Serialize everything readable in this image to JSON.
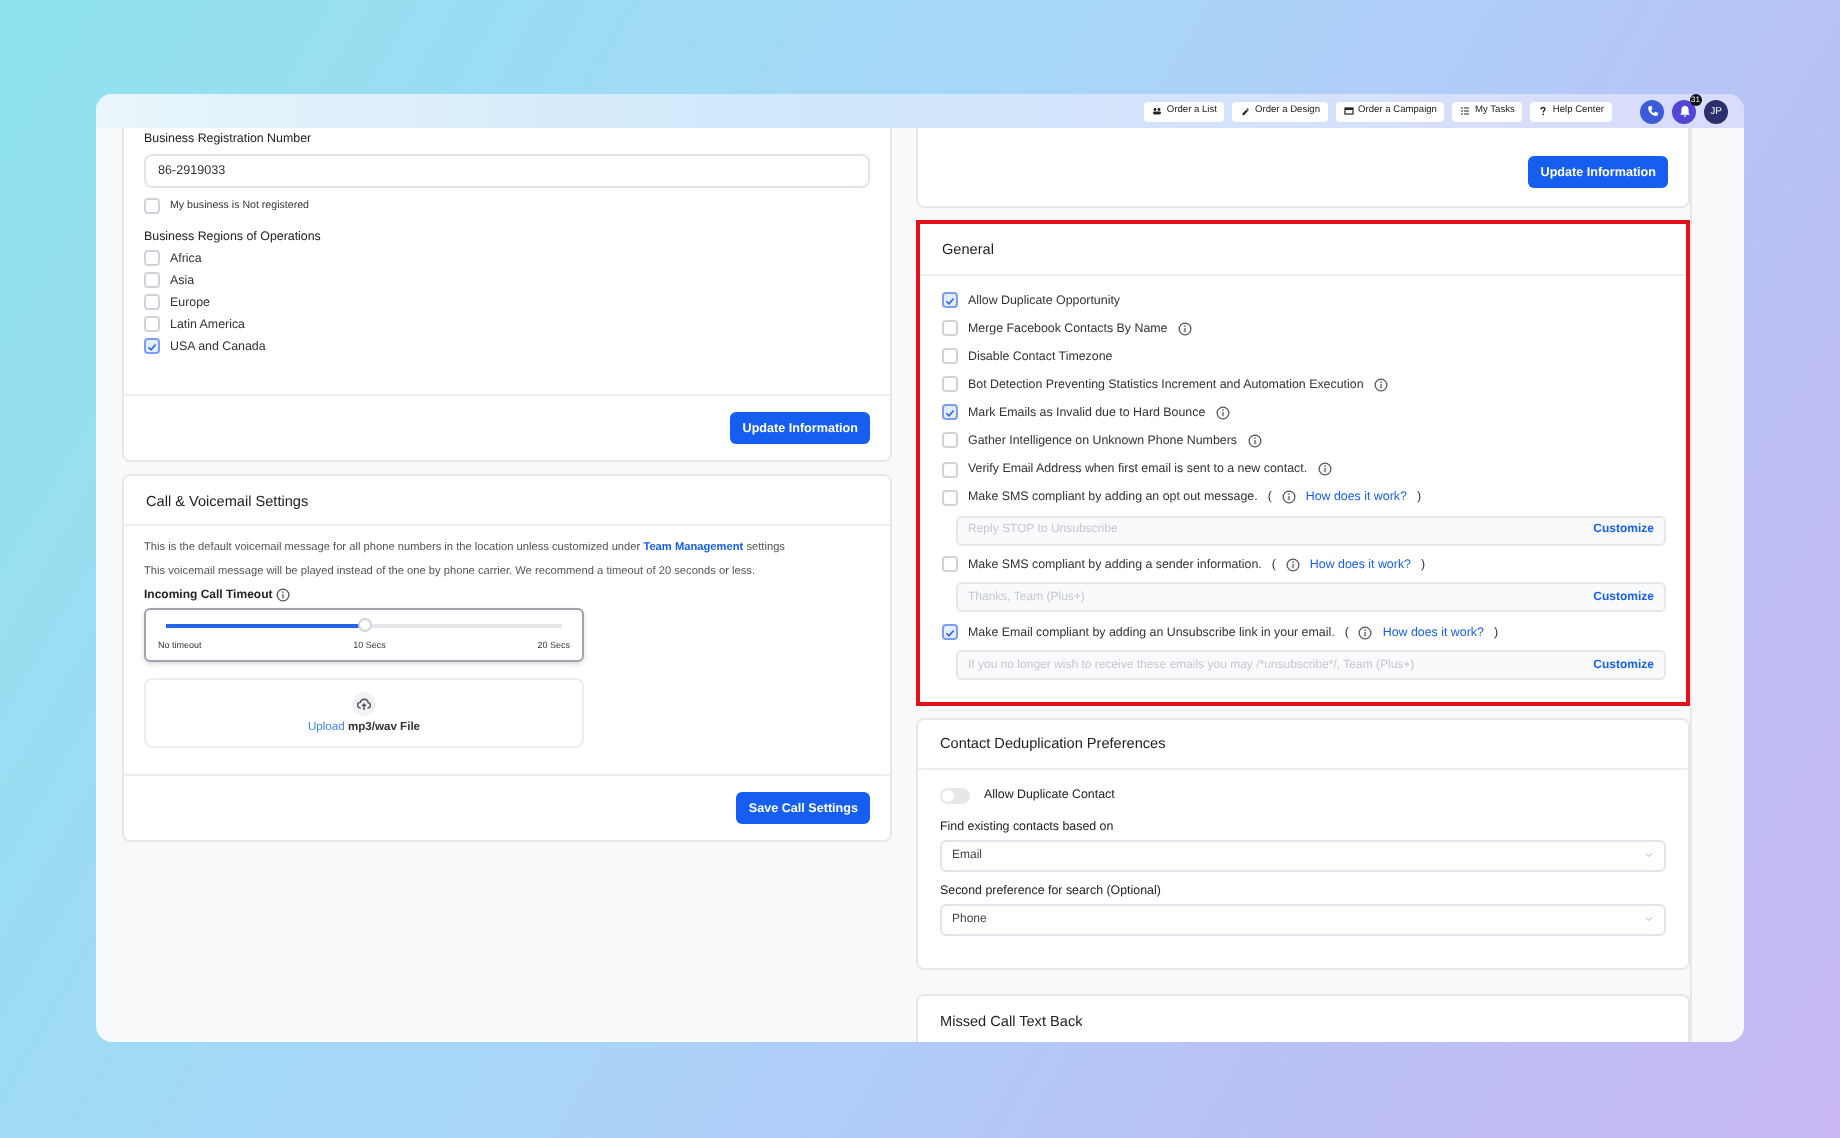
{
  "top_bar": {
    "buttons": [
      {
        "label": "Order a List"
      },
      {
        "label": "Order a Design"
      },
      {
        "label": "Order a Campaign"
      },
      {
        "label": "My Tasks"
      },
      {
        "label": "Help Center"
      }
    ],
    "notification_count": "31",
    "avatar": "JP"
  },
  "business": {
    "registration_label": "Business Registration Number",
    "registration_value": "86-2919033",
    "not_registered": {
      "label": "My business is Not registered",
      "checked": false
    },
    "regions_label": "Business Regions of Operations",
    "regions": [
      {
        "label": "Africa",
        "checked": false
      },
      {
        "label": "Asia",
        "checked": false
      },
      {
        "label": "Europe",
        "checked": false
      },
      {
        "label": "Latin America",
        "checked": false
      },
      {
        "label": "USA and Canada",
        "checked": true
      }
    ],
    "button": "Update Information"
  },
  "call_settings": {
    "title": "Call & Voicemail Settings",
    "line1_before": "This is the default voicemail message for all phone numbers in the location unless customized under",
    "line1_link": "Team Management",
    "line1_after": "settings",
    "line2": "This voicemail message will be played instead of the one by phone carrier. We recommend a timeout of 20 seconds or less.",
    "timeout_label": "Incoming Call Timeout",
    "timeout": {
      "level": 0.5,
      "ticks": [
        "No timeout",
        "10 Secs",
        "20 Secs"
      ]
    },
    "upload_link": "Upload",
    "upload_text": "mp3/wav File",
    "button": "Save Call Settings"
  },
  "top_right_button": "Update Information",
  "general": {
    "title": "General",
    "highlighted": true,
    "options": [
      {
        "kind": "plain",
        "label": "Allow Duplicate Opportunity",
        "checked": true,
        "info": false
      },
      {
        "kind": "plain",
        "label": "Merge Facebook Contacts By Name",
        "checked": false,
        "info": true
      },
      {
        "kind": "plain",
        "label": "Disable Contact Timezone",
        "checked": false,
        "info": false
      },
      {
        "kind": "plain",
        "label": "Bot Detection Preventing Statistics Increment and Automation Execution",
        "checked": false,
        "info": true
      },
      {
        "kind": "plain",
        "label": "Mark Emails as Invalid due to Hard Bounce",
        "checked": true,
        "info": true
      },
      {
        "kind": "plain",
        "label": "Gather Intelligence on Unknown Phone Numbers",
        "checked": false,
        "info": true
      },
      {
        "kind": "plain",
        "label": "Verify Email Address when first email is sent to a new contact.",
        "checked": false,
        "info": true
      },
      {
        "kind": "compliance",
        "label": "Make SMS compliant by adding an opt out message.",
        "checked": false,
        "info": true,
        "open": "(",
        "help_link": "How does it work?",
        "close": ")",
        "placeholder": "Reply STOP to Unsubscribe",
        "action": "Customize"
      },
      {
        "kind": "compliance",
        "label": "Make SMS compliant by adding a sender information.",
        "checked": false,
        "info": true,
        "open": "(",
        "help_link": "How does it work?",
        "close": ")",
        "placeholder": "Thanks, Team (Plus+)",
        "action": "Customize"
      },
      {
        "kind": "compliance",
        "label": "Make Email compliant by adding an Unsubscribe link in your email.",
        "checked": true,
        "info": true,
        "open": "(",
        "help_link": "How does it work?",
        "close": ")",
        "placeholder": "If you no longer wish to receive these emails you may /*unsubscribe*/, Team (Plus+)",
        "action": "Customize"
      }
    ]
  },
  "dedup": {
    "title": "Contact Deduplication Preferences",
    "toggle": {
      "label": "Allow Duplicate Contact",
      "on": false
    },
    "fields": [
      {
        "label": "Find existing contacts based on",
        "value": "Email"
      },
      {
        "label": "Second preference for search (Optional)",
        "value": "Phone"
      }
    ]
  },
  "missed_call": {
    "title": "Missed Call Text Back"
  }
}
